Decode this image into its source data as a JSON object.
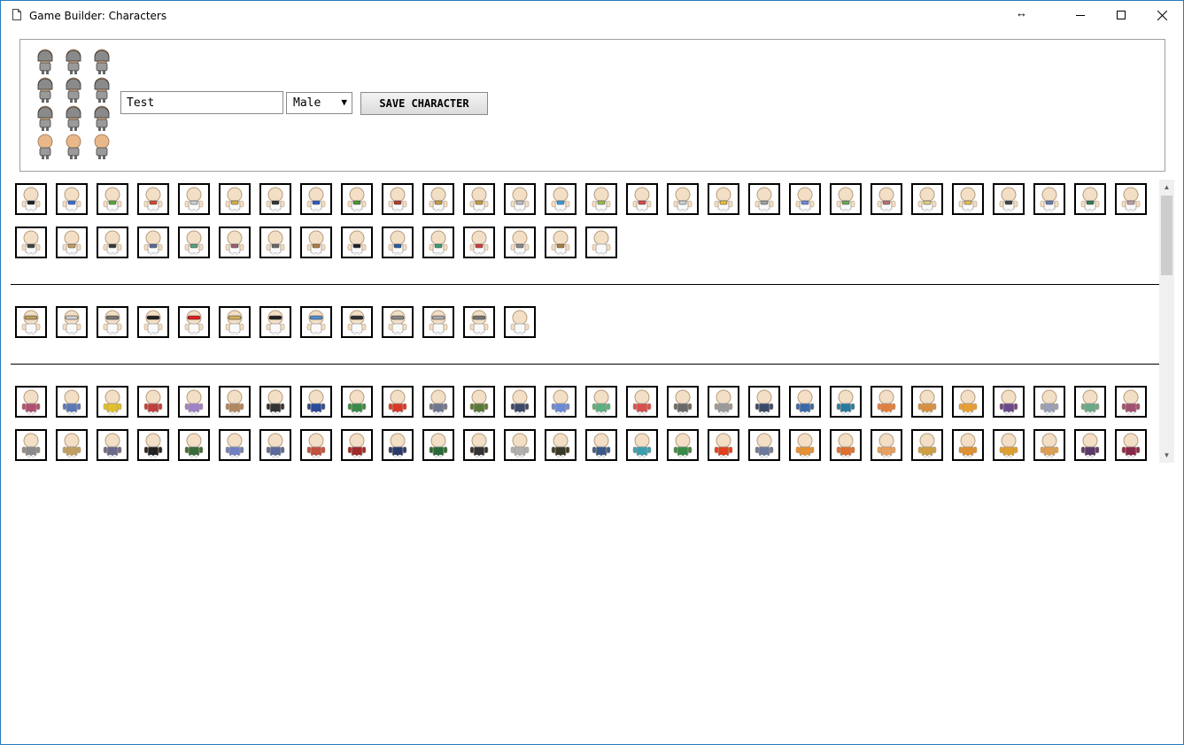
{
  "window": {
    "title": "Game Builder: Characters"
  },
  "titlebar_buttons": {
    "minimize_icon": "minimize-icon",
    "maximize_icon": "maximize-icon",
    "close_icon": "close-icon",
    "resize_icon": "horizontal-resize-icon"
  },
  "character": {
    "name": "Test",
    "gender": "Male",
    "save_label": "SAVE CHARACTER"
  },
  "colors": {
    "skin": "#f2dfc6",
    "outline": "#000000",
    "tile_border": "#000000",
    "window_border": "#2b79b9"
  },
  "sections": [
    {
      "id": "accessories",
      "items": [
        "#222",
        "#3a6fd8",
        "#5ca83a",
        "#d84a2a",
        "#cfcfd6",
        "#d9b13a",
        "#333333",
        "#2d5cc8",
        "#4a9a2a",
        "#b83a2a",
        "#c8a040",
        "#c9a040",
        "#c0c0c0",
        "#3aa0e0",
        "#9ac050",
        "#d84a4a",
        "#d0d0d0",
        "#e8c040",
        "#a0a0a0",
        "#6a8ad8",
        "#6aaa5a",
        "#c07070",
        "#e0d080",
        "#e8c050",
        "#444",
        "#6a80b0",
        "#3a7a5a",
        "#c8a0a0",
        "#444",
        "#c8a060",
        "#3a3a3a",
        "#5a6aa0",
        "#5aa080",
        "#a06070",
        "#6a6a6a",
        "#b08040",
        "#222",
        "#2a5aa8",
        "#3aa070",
        "#d83a3a",
        "#8a8a8a",
        "#b08040",
        "#ffffff"
      ]
    },
    {
      "id": "headwear",
      "items": [
        "#c0a060",
        "#d0d0d0",
        "#777",
        "#222",
        "#e02020",
        "#d0b060",
        "#222",
        "#5090d0",
        "#333",
        "#888",
        "#aaa",
        "#777",
        "#ffffff"
      ]
    },
    {
      "id": "shirts",
      "items": [
        "#b05070",
        "#5a78b8",
        "#e0c030",
        "#c04040",
        "#a080c8",
        "#b08860",
        "#333",
        "#2a4a98",
        "#3a8a4a",
        "#d83a2a",
        "#707890",
        "#5a7a3a",
        "#3a4a6a",
        "#6a8ad8",
        "#5ab080",
        "#d85050",
        "#6a6a6a",
        "#9a9a9a",
        "#3a4a6a",
        "#3a6aa8",
        "#2a7aa0",
        "#e08040",
        "#d89040",
        "#e8a030",
        "#6a4a8a",
        "#9aa0b8",
        "#6aaa8a",
        "#a05070",
        "#8a8a8a",
        "#c0a060",
        "#6a6a8a",
        "#222",
        "#3a6a3a",
        "#7080c0",
        "#5a6a9a",
        "#c05040",
        "#a02a2a",
        "#2a3a6a",
        "#2a6a3a",
        "#333",
        "#b0b0b0",
        "#3a3a2a",
        "#3a5a8a",
        "#3aa0b0",
        "#3a8a4a",
        "#e04020",
        "#6a7a9a",
        "#e89030",
        "#e07030",
        "#e8a060",
        "#d0a040",
        "#e09030",
        "#e0a030",
        "#e0a050",
        "#5a3a6a",
        "#8a2a4a"
      ]
    }
  ]
}
